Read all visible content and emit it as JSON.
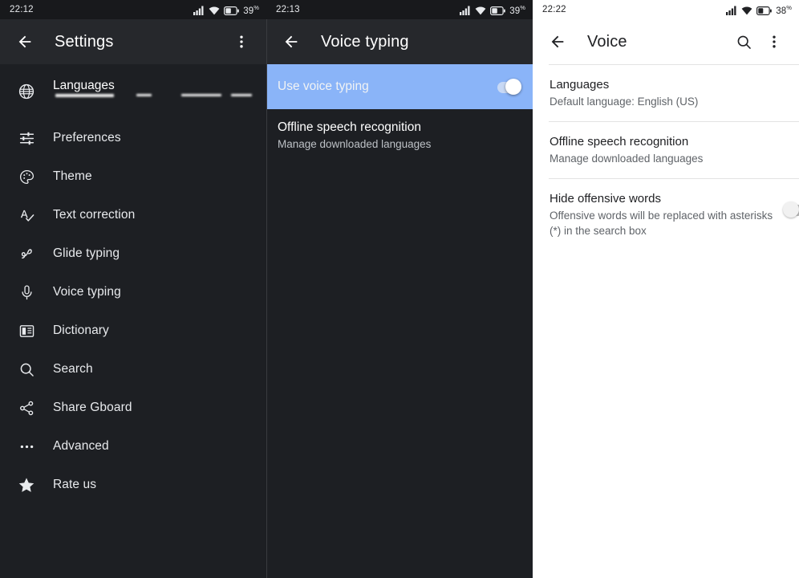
{
  "panels": [
    {
      "theme": "dark",
      "statusbar": {
        "time": "22:12",
        "battery": "39",
        "percent_sign": "%"
      },
      "appbar": {
        "back_icon": "arrow-back-icon",
        "title": "Settings",
        "overflow_icon": "more-vert-icon"
      },
      "languages_row": {
        "icon": "globe-icon",
        "label": "Languages",
        "subtitle_redacted": true
      },
      "items": [
        {
          "icon": "tune-icon",
          "label": "Preferences"
        },
        {
          "icon": "palette-icon",
          "label": "Theme"
        },
        {
          "icon": "spellcheck-icon",
          "label": "Text correction"
        },
        {
          "icon": "gesture-icon",
          "label": "Glide typing"
        },
        {
          "icon": "microphone-icon",
          "label": "Voice typing"
        },
        {
          "icon": "book-icon",
          "label": "Dictionary"
        },
        {
          "icon": "search-icon",
          "label": "Search"
        },
        {
          "icon": "share-icon",
          "label": "Share Gboard"
        },
        {
          "icon": "more-horiz-icon",
          "label": "Advanced"
        },
        {
          "icon": "star-icon",
          "label": "Rate us"
        }
      ]
    },
    {
      "theme": "dark",
      "statusbar": {
        "time": "22:13",
        "battery": "39",
        "percent_sign": "%"
      },
      "appbar": {
        "back_icon": "arrow-back-icon",
        "title": "Voice typing"
      },
      "rows": [
        {
          "label": "Use voice typing",
          "highlighted": true,
          "switch": "on"
        },
        {
          "title": "Offline speech recognition",
          "subtitle": "Manage downloaded languages"
        }
      ]
    },
    {
      "theme": "light",
      "statusbar": {
        "time": "22:22",
        "battery": "38",
        "percent_sign": "%"
      },
      "appbar": {
        "back_icon": "arrow-back-icon",
        "title": "Voice",
        "search_icon": "search-icon",
        "overflow_icon": "more-vert-icon"
      },
      "rows": [
        {
          "title": "Languages",
          "subtitle": "Default language: English (US)"
        },
        {
          "title": "Offline speech recognition",
          "subtitle": "Manage downloaded languages"
        },
        {
          "title": "Hide offensive words",
          "subtitle": "Offensive words will be replaced with asterisks (*) in the search box",
          "switch": "off"
        }
      ]
    }
  ],
  "colors": {
    "dark_bg": "#1d1f23",
    "dark_appbar": "#26282c",
    "dark_statusbar": "#18191c",
    "highlight_blue": "#8ab4f8",
    "light_bg": "#ffffff",
    "divider": "#e3e3e3"
  }
}
